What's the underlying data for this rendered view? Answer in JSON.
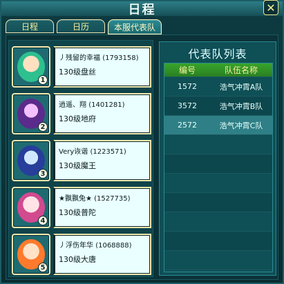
{
  "window": {
    "title": "日程",
    "close_icon": "close-icon"
  },
  "tabs": [
    {
      "label": "日程",
      "active": false
    },
    {
      "label": "日历",
      "active": false
    },
    {
      "label": "本服代表队",
      "active": true
    }
  ],
  "left_list": {
    "items": [
      {
        "index": "1",
        "name": "丿残留的幸福",
        "id": "(1793158)",
        "detail": "130级盘丝",
        "avatar_icon": "avatar-icon"
      },
      {
        "index": "2",
        "name": "逍遥、翔",
        "id": "(1401281)",
        "detail": "130级地府",
        "avatar_icon": "avatar-icon"
      },
      {
        "index": "3",
        "name": "Very诙谐",
        "id": "(1223571)",
        "detail": "130级魔王",
        "avatar_icon": "avatar-icon"
      },
      {
        "index": "4",
        "name": "★飘飘兔★",
        "id": "(1527735)",
        "detail": "130级普陀",
        "avatar_icon": "avatar-icon"
      },
      {
        "index": "5",
        "name": "丿浮伤年华",
        "id": "(1068888)",
        "detail": "130级大唐",
        "avatar_icon": "avatar-icon"
      }
    ]
  },
  "right_panel": {
    "title": "代表队列表",
    "headers": [
      "编号",
      "队伍名称"
    ],
    "rows": [
      {
        "no": "1572",
        "team": "浩气冲霄A队",
        "selected": false
      },
      {
        "no": "3572",
        "team": "浩气冲霄B队",
        "selected": false
      },
      {
        "no": "2572",
        "team": "浩气冲霄C队",
        "selected": true
      },
      {
        "no": "",
        "team": "",
        "selected": false
      },
      {
        "no": "",
        "team": "",
        "selected": false
      },
      {
        "no": "",
        "team": "",
        "selected": false
      },
      {
        "no": "",
        "team": "",
        "selected": false
      },
      {
        "no": "",
        "team": "",
        "selected": false
      },
      {
        "no": "",
        "team": "",
        "selected": false
      },
      {
        "no": "",
        "team": "",
        "selected": false
      }
    ]
  },
  "colors": {
    "accent_gold": "#f7ef9a",
    "panel_teal": "#0f4f56",
    "header_green": "#38a42c"
  }
}
